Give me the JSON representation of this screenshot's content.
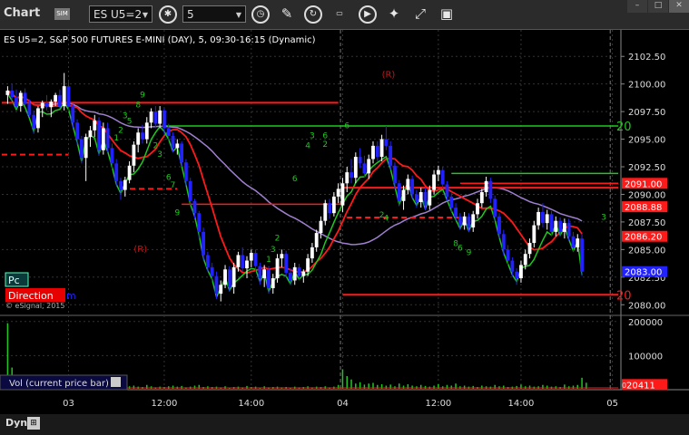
{
  "toolbar": {
    "title": "Chart",
    "badge": "SIM",
    "symbol": "ES U5=2",
    "interval": "5"
  },
  "chart_header": "ES U5=2, S&P 500 FUTURES E-MINI (DAY), 5, 09:30-16:15 (Dynamic)",
  "watermark": "© eSignal, 2015",
  "pc_label": "Pc",
  "direction_label": "Direction",
  "direction_suffix": "m",
  "vol_label": "Vol (current price bar)",
  "dyn_label": "Dyn",
  "colors": {
    "up": "#ffffff",
    "down": "#2222ff",
    "grid": "#333333",
    "red": "#ff1a1a",
    "green": "#1ec81e",
    "purple": "#a080d0"
  },
  "chart_data": {
    "type": "candlestick",
    "y_ticks": [
      "2102.50",
      "2100.00",
      "2097.50",
      "2095.00",
      "2092.50",
      "2090.00",
      "2087.50",
      "2085.00",
      "2082.50",
      "2080.00"
    ],
    "ylim": [
      2079,
      2104
    ],
    "x_ticks": [
      {
        "label": "03",
        "bar": 14
      },
      {
        "label": "12:00",
        "bar": 36
      },
      {
        "label": "14:00",
        "bar": 56
      },
      {
        "label": "04",
        "bar": 77
      },
      {
        "label": "12:00",
        "bar": 99
      },
      {
        "label": "14:00",
        "bar": 118
      },
      {
        "label": "05",
        "bar": 139
      }
    ],
    "day_separators": [
      77,
      139
    ],
    "n_bars": 140,
    "bars": [
      [
        2099.0,
        2099.8,
        2098.2,
        2099.4
      ],
      [
        2099.4,
        2100.0,
        2098.5,
        2098.8
      ],
      [
        2098.8,
        2099.5,
        2097.8,
        2098.0
      ],
      [
        2098.0,
        2099.4,
        2097.5,
        2099.2
      ],
      [
        2099.2,
        2099.6,
        2098.0,
        2098.2
      ],
      [
        2098.2,
        2098.6,
        2097.0,
        2097.2
      ],
      [
        2097.2,
        2097.6,
        2095.5,
        2096.0
      ],
      [
        2096.0,
        2098.0,
        2095.6,
        2097.8
      ],
      [
        2097.8,
        2098.5,
        2097.0,
        2098.3
      ],
      [
        2098.3,
        2099.0,
        2097.6,
        2097.9
      ],
      [
        2097.9,
        2098.6,
        2097.0,
        2098.4
      ],
      [
        2098.4,
        2099.2,
        2098.0,
        2099.0
      ],
      [
        2099.0,
        2099.5,
        2097.8,
        2098.0
      ],
      [
        2098.0,
        2101.0,
        2097.6,
        2099.8
      ],
      [
        2099.8,
        2100.2,
        2097.5,
        2098.0
      ],
      [
        2098.0,
        2098.2,
        2096.0,
        2096.5
      ],
      [
        2096.5,
        2096.8,
        2094.5,
        2095.0
      ],
      [
        2095.0,
        2095.3,
        2092.8,
        2093.3
      ],
      [
        2093.3,
        2095.5,
        2091.2,
        2095.2
      ],
      [
        2095.2,
        2096.2,
        2094.3,
        2095.8
      ],
      [
        2095.8,
        2097.2,
        2095.2,
        2096.7
      ],
      [
        2096.7,
        2097.0,
        2093.5,
        2094.0
      ],
      [
        2094.0,
        2096.5,
        2093.6,
        2096.0
      ],
      [
        2096.0,
        2096.5,
        2093.8,
        2094.2
      ],
      [
        2094.2,
        2094.6,
        2092.3,
        2092.8
      ],
      [
        2092.8,
        2093.2,
        2090.8,
        2091.2
      ],
      [
        2091.2,
        2091.5,
        2089.5,
        2090.4
      ],
      [
        2090.4,
        2091.6,
        2089.8,
        2091.3
      ],
      [
        2091.3,
        2093.0,
        2091.0,
        2092.6
      ],
      [
        2092.6,
        2094.8,
        2092.0,
        2094.5
      ],
      [
        2094.5,
        2096.0,
        2093.8,
        2095.6
      ],
      [
        2095.6,
        2096.3,
        2094.6,
        2095.0
      ],
      [
        2095.0,
        2097.0,
        2094.6,
        2096.5
      ],
      [
        2096.5,
        2097.8,
        2096.0,
        2097.5
      ],
      [
        2097.5,
        2098.0,
        2096.0,
        2096.4
      ],
      [
        2096.4,
        2098.0,
        2096.0,
        2097.6
      ],
      [
        2097.6,
        2097.8,
        2095.5,
        2096.0
      ],
      [
        2096.0,
        2096.4,
        2094.8,
        2095.3
      ],
      [
        2095.3,
        2095.6,
        2093.8,
        2094.2
      ],
      [
        2094.2,
        2095.0,
        2093.6,
        2094.6
      ],
      [
        2094.6,
        2094.8,
        2092.5,
        2092.9
      ],
      [
        2092.9,
        2093.2,
        2090.8,
        2091.2
      ],
      [
        2091.2,
        2091.5,
        2089.0,
        2089.4
      ],
      [
        2089.4,
        2089.6,
        2087.8,
        2088.3
      ],
      [
        2088.3,
        2088.5,
        2086.0,
        2086.6
      ],
      [
        2086.6,
        2087.0,
        2084.0,
        2084.5
      ],
      [
        2084.5,
        2084.8,
        2083.0,
        2083.4
      ],
      [
        2083.4,
        2083.8,
        2082.0,
        2082.6
      ],
      [
        2082.6,
        2083.0,
        2080.5,
        2081.0
      ],
      [
        2081.0,
        2082.2,
        2080.3,
        2081.8
      ],
      [
        2081.8,
        2083.6,
        2081.5,
        2083.2
      ],
      [
        2083.2,
        2083.5,
        2081.2,
        2081.6
      ],
      [
        2081.6,
        2083.8,
        2081.0,
        2083.4
      ],
      [
        2083.4,
        2084.8,
        2083.0,
        2084.5
      ],
      [
        2084.5,
        2085.2,
        2083.0,
        2083.3
      ],
      [
        2083.3,
        2084.4,
        2082.4,
        2084.0
      ],
      [
        2084.0,
        2085.0,
        2083.4,
        2084.7
      ],
      [
        2084.7,
        2085.0,
        2083.0,
        2083.5
      ],
      [
        2083.5,
        2083.8,
        2081.8,
        2082.4
      ],
      [
        2082.4,
        2083.6,
        2081.6,
        2083.2
      ],
      [
        2083.2,
        2083.5,
        2081.0,
        2081.5
      ],
      [
        2081.5,
        2082.8,
        2081.0,
        2082.4
      ],
      [
        2082.4,
        2084.6,
        2082.0,
        2084.2
      ],
      [
        2084.2,
        2085.0,
        2083.4,
        2084.6
      ],
      [
        2084.6,
        2084.9,
        2082.5,
        2082.9
      ],
      [
        2082.9,
        2083.3,
        2081.8,
        2082.2
      ],
      [
        2082.2,
        2083.8,
        2081.8,
        2083.4
      ],
      [
        2083.4,
        2083.7,
        2082.2,
        2082.6
      ],
      [
        2082.6,
        2083.2,
        2082.0,
        2083.0
      ],
      [
        2083.0,
        2084.6,
        2082.6,
        2084.2
      ],
      [
        2084.2,
        2085.6,
        2083.8,
        2085.2
      ],
      [
        2085.2,
        2086.8,
        2084.8,
        2086.5
      ],
      [
        2086.5,
        2088.0,
        2086.0,
        2087.6
      ],
      [
        2087.6,
        2089.5,
        2087.2,
        2089.2
      ],
      [
        2089.2,
        2089.6,
        2087.8,
        2088.3
      ],
      [
        2088.3,
        2090.2,
        2088.0,
        2089.8
      ],
      [
        2089.8,
        2091.0,
        2089.2,
        2090.5
      ],
      [
        2089.0,
        2091.5,
        2088.4,
        2091.0
      ],
      [
        2091.0,
        2092.5,
        2090.2,
        2092.0
      ],
      [
        2092.0,
        2093.2,
        2091.0,
        2091.5
      ],
      [
        2091.5,
        2093.8,
        2091.0,
        2093.4
      ],
      [
        2093.4,
        2094.2,
        2092.4,
        2092.8
      ],
      [
        2092.8,
        2093.5,
        2091.5,
        2091.9
      ],
      [
        2091.9,
        2093.6,
        2091.4,
        2093.2
      ],
      [
        2093.2,
        2094.8,
        2092.8,
        2094.4
      ],
      [
        2094.4,
        2094.8,
        2093.0,
        2093.4
      ],
      [
        2093.4,
        2095.4,
        2093.0,
        2095.0
      ],
      [
        2095.0,
        2096.2,
        2094.0,
        2094.4
      ],
      [
        2094.4,
        2094.8,
        2092.2,
        2092.6
      ],
      [
        2092.6,
        2092.9,
        2090.5,
        2091.0
      ],
      [
        2091.0,
        2091.3,
        2089.0,
        2089.4
      ],
      [
        2089.4,
        2090.8,
        2088.6,
        2090.4
      ],
      [
        2090.4,
        2091.8,
        2090.0,
        2091.4
      ],
      [
        2091.4,
        2091.7,
        2089.6,
        2090.0
      ],
      [
        2090.0,
        2090.4,
        2088.8,
        2089.3
      ],
      [
        2089.3,
        2090.6,
        2088.8,
        2090.2
      ],
      [
        2090.2,
        2090.6,
        2088.6,
        2089.0
      ],
      [
        2089.0,
        2090.8,
        2088.6,
        2090.4
      ],
      [
        2090.4,
        2092.2,
        2090.0,
        2091.8
      ],
      [
        2091.8,
        2092.6,
        2091.2,
        2092.2
      ],
      [
        2092.2,
        2092.5,
        2090.5,
        2090.9
      ],
      [
        2090.9,
        2091.2,
        2089.4,
        2089.8
      ],
      [
        2089.8,
        2090.1,
        2088.4,
        2088.8
      ],
      [
        2088.8,
        2089.2,
        2087.6,
        2088.0
      ],
      [
        2088.0,
        2088.3,
        2086.8,
        2087.2
      ],
      [
        2087.2,
        2088.4,
        2086.8,
        2088.0
      ],
      [
        2088.0,
        2088.3,
        2086.6,
        2087.0
      ],
      [
        2087.0,
        2088.5,
        2086.6,
        2088.2
      ],
      [
        2088.2,
        2089.6,
        2087.8,
        2089.2
      ],
      [
        2089.2,
        2090.5,
        2088.8,
        2090.2
      ],
      [
        2090.2,
        2091.6,
        2089.8,
        2091.2
      ],
      [
        2091.2,
        2091.5,
        2089.2,
        2089.6
      ],
      [
        2089.6,
        2089.9,
        2087.6,
        2088.0
      ],
      [
        2088.0,
        2088.3,
        2086.0,
        2086.4
      ],
      [
        2086.4,
        2086.8,
        2084.5,
        2085.0
      ],
      [
        2085.0,
        2085.4,
        2083.6,
        2084.0
      ],
      [
        2084.0,
        2084.3,
        2082.6,
        2083.0
      ],
      [
        2083.0,
        2083.3,
        2081.8,
        2082.4
      ],
      [
        2082.4,
        2084.0,
        2082.0,
        2083.6
      ],
      [
        2083.6,
        2085.0,
        2083.2,
        2084.6
      ],
      [
        2084.6,
        2086.0,
        2084.2,
        2085.6
      ],
      [
        2085.6,
        2087.6,
        2085.2,
        2087.2
      ],
      [
        2087.2,
        2088.8,
        2086.8,
        2088.4
      ],
      [
        2088.4,
        2089.2,
        2087.0,
        2087.4
      ],
      [
        2087.4,
        2088.6,
        2086.8,
        2088.2
      ],
      [
        2088.2,
        2088.5,
        2086.2,
        2086.6
      ],
      [
        2086.6,
        2088.0,
        2086.2,
        2087.6
      ],
      [
        2087.6,
        2087.9,
        2086.2,
        2086.6
      ],
      [
        2086.6,
        2087.8,
        2086.0,
        2087.4
      ],
      [
        2087.4,
        2087.8,
        2085.8,
        2086.2
      ],
      [
        2086.2,
        2086.6,
        2084.8,
        2085.2
      ],
      [
        2085.2,
        2086.4,
        2084.8,
        2086.0
      ],
      [
        2086.0,
        2086.4,
        2082.6,
        2083.0
      ]
    ],
    "volume": [
      195000,
      65000,
      30000,
      20000,
      25000,
      22000,
      18000,
      15000,
      20000,
      18000,
      12000,
      14000,
      16000,
      20000,
      25000,
      18000,
      15000,
      14000,
      30000,
      12000,
      16000,
      22000,
      10000,
      18000,
      12000,
      14000,
      20000,
      11000,
      10000,
      12000,
      9000,
      8000,
      14000,
      10000,
      7000,
      9000,
      8000,
      10000,
      12000,
      9000,
      11000,
      7000,
      9000,
      12000,
      14000,
      8000,
      10000,
      8000,
      9000,
      7000,
      10000,
      6000,
      8000,
      9000,
      7000,
      11000,
      8000,
      9000,
      6000,
      10000,
      7000,
      8000,
      9000,
      7000,
      8000,
      6000,
      9000,
      7000,
      8000,
      10000,
      7000,
      9000,
      8000,
      10000,
      7000,
      9000,
      14000,
      60000,
      40000,
      30000,
      18000,
      22000,
      15000,
      18000,
      20000,
      14000,
      16000,
      12000,
      15000,
      10000,
      18000,
      12000,
      16000,
      12000,
      10000,
      14000,
      11000,
      9000,
      12000,
      16000,
      10000,
      14000,
      12000,
      18000,
      10000,
      12000,
      9000,
      11000,
      8000,
      12000,
      10000,
      9000,
      14000,
      10000,
      12000,
      8000,
      9000,
      11000,
      15000,
      10000,
      12000,
      9000,
      10000,
      14000,
      12000,
      9000,
      10000,
      8000,
      15000,
      10000,
      12000,
      14000,
      35000,
      20411
    ],
    "vol_ticks": [
      "200000",
      "100000"
    ],
    "vol_ylim": [
      0,
      210000
    ],
    "current_vol_label": "20411",
    "levels": {
      "red_upper": 2098.3,
      "green_upper": 2096.2,
      "red_lower": 2080.9,
      "red_mid_day2": 2090.6
    },
    "level_labels": {
      "green_top": "20",
      "red_bottom": "20",
      "r_marker": "(R)"
    },
    "price_labels": [
      {
        "text": "2091.00",
        "y": 2091.0,
        "color": "#ff1a1a"
      },
      {
        "text": "2088.88",
        "y": 2088.88,
        "color": "#ff1a1a"
      },
      {
        "text": "2086.20",
        "y": 2086.2,
        "color": "#ff1a1a"
      },
      {
        "text": "2083.00",
        "y": 2083.0,
        "color": "#2222ff"
      }
    ],
    "seq_labels": [
      {
        "t": "9",
        "bar": 31,
        "y": 2098.8,
        "c": "#1ec81e"
      },
      {
        "t": "8",
        "bar": 30,
        "y": 2097.9,
        "c": "#1ec81e"
      },
      {
        "t": "3",
        "bar": 27,
        "y": 2096.9,
        "c": "#1ec81e"
      },
      {
        "t": "5",
        "bar": 28,
        "y": 2096.4,
        "c": "#1ec81e"
      },
      {
        "t": "2",
        "bar": 26,
        "y": 2095.6,
        "c": "#1ec81e"
      },
      {
        "t": "1",
        "bar": 25,
        "y": 2094.9,
        "c": "#1ec81e"
      },
      {
        "t": "2",
        "bar": 34,
        "y": 2094.2,
        "c": "#1ec81e"
      },
      {
        "t": "3",
        "bar": 35,
        "y": 2093.4,
        "c": "#1ec81e"
      },
      {
        "t": "6",
        "bar": 37,
        "y": 2091.3,
        "c": "#1ec81e"
      },
      {
        "t": "7",
        "bar": 38,
        "y": 2090.6,
        "c": "#1ec81e"
      },
      {
        "t": "9",
        "bar": 39,
        "y": 2088.1,
        "c": "#1ec81e"
      },
      {
        "t": "2",
        "bar": 62,
        "y": 2085.8,
        "c": "#1ec81e"
      },
      {
        "t": "3",
        "bar": 61,
        "y": 2084.8,
        "c": "#1ec81e"
      },
      {
        "t": "1",
        "bar": 60,
        "y": 2083.9,
        "c": "#1ec81e"
      },
      {
        "t": "6",
        "bar": 66,
        "y": 2091.2,
        "c": "#1ec81e"
      },
      {
        "t": "3",
        "bar": 70,
        "y": 2095.1,
        "c": "#1ec81e"
      },
      {
        "t": "6",
        "bar": 73,
        "y": 2095.1,
        "c": "#1ec81e"
      },
      {
        "t": "2",
        "bar": 73,
        "y": 2094.3,
        "c": "#1ec81e"
      },
      {
        "t": "4",
        "bar": 69,
        "y": 2094.2,
        "c": "#1ec81e"
      },
      {
        "t": "6",
        "bar": 78,
        "y": 2096.0,
        "c": "#1ec81e"
      },
      {
        "t": "2",
        "bar": 86,
        "y": 2087.9,
        "c": "#1ec81e"
      },
      {
        "t": "4",
        "bar": 87,
        "y": 2087.6,
        "c": "#1ec81e"
      },
      {
        "t": "8",
        "bar": 103,
        "y": 2085.3,
        "c": "#1ec81e"
      },
      {
        "t": "6",
        "bar": 104,
        "y": 2084.9,
        "c": "#1ec81e"
      },
      {
        "t": "9",
        "bar": 106,
        "y": 2084.5,
        "c": "#1ec81e"
      },
      {
        "t": "3",
        "bar": 137,
        "y": 2087.7,
        "c": "#1ec81e"
      }
    ]
  }
}
